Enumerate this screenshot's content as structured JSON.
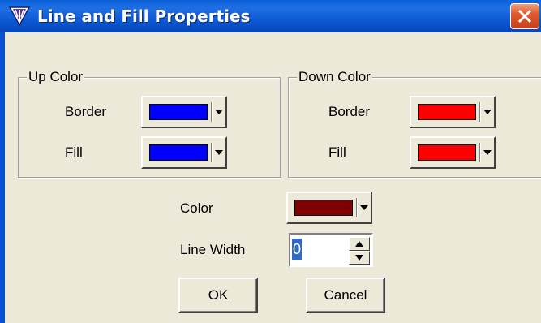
{
  "window": {
    "title": "Line and Fill Properties",
    "title_icon": "trident-logo-icon",
    "close_icon": "close-icon"
  },
  "up_color": {
    "legend": "Up Color",
    "border_label": "Border",
    "border_color": "#0000ff",
    "fill_label": "Fill",
    "fill_color": "#0000ff"
  },
  "down_color": {
    "legend": "Down Color",
    "border_label": "Border",
    "border_color": "#ff0000",
    "fill_label": "Fill",
    "fill_color": "#ff0000"
  },
  "line": {
    "color_label": "Color",
    "color": "#800000",
    "width_label": "Line Width",
    "width_value": "0"
  },
  "buttons": {
    "ok": "OK",
    "cancel": "Cancel"
  }
}
